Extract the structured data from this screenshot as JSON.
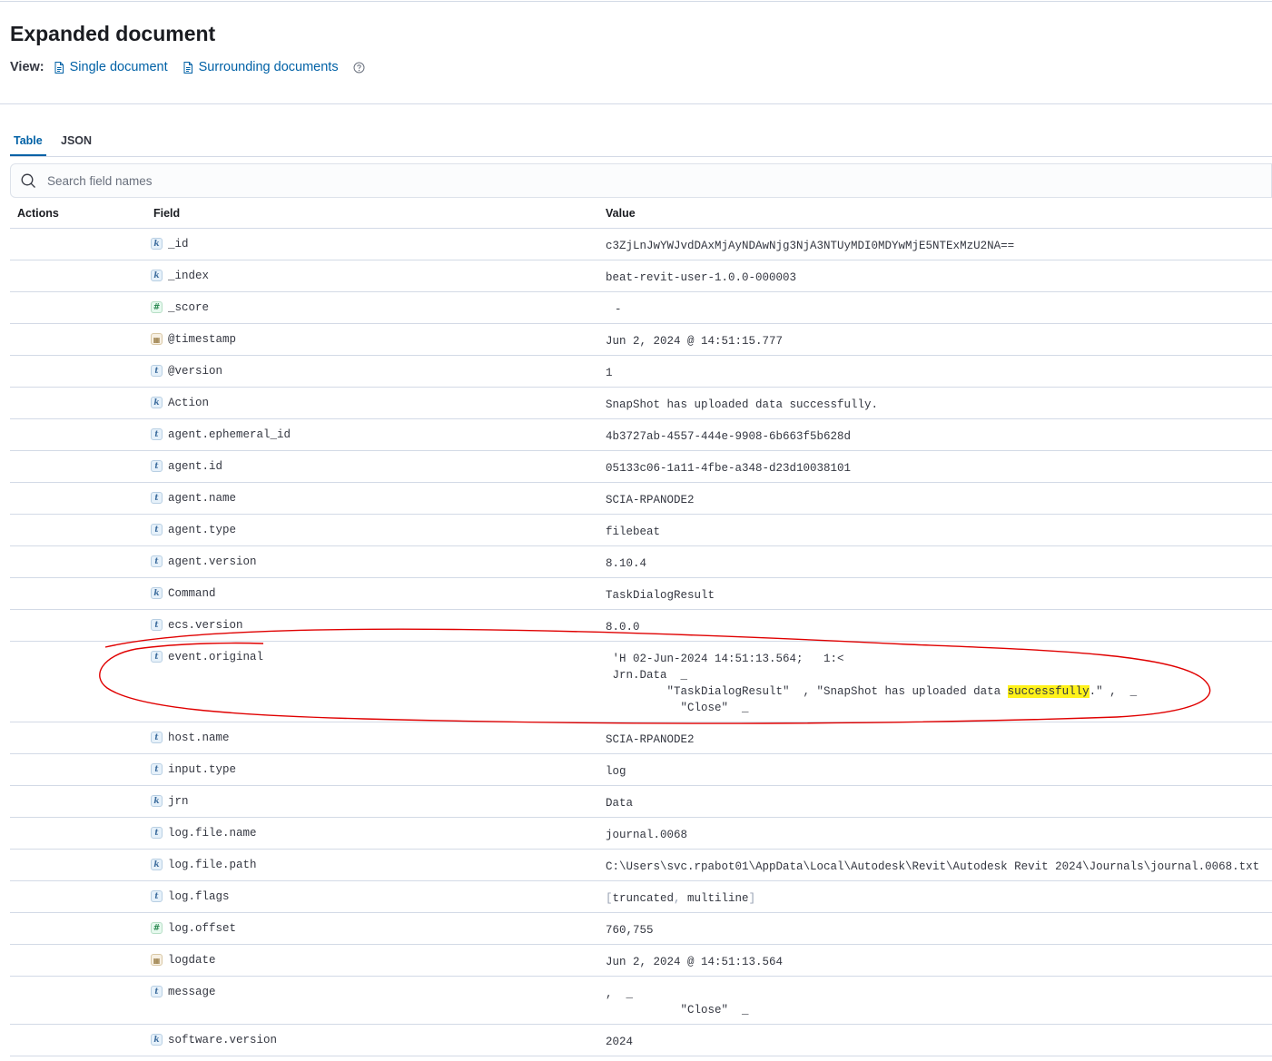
{
  "header": {
    "title": "Expanded document",
    "view_label": "View:",
    "single_document": "Single document",
    "surrounding_documents": "Surrounding documents"
  },
  "tabs": [
    {
      "label": "Table",
      "active": true
    },
    {
      "label": "JSON",
      "active": false
    }
  ],
  "search": {
    "placeholder": "Search field names"
  },
  "table": {
    "headers": {
      "actions": "Actions",
      "field": "Field",
      "value": "Value"
    },
    "rows": [
      {
        "type": "keyword",
        "field": "_id",
        "value": "c3ZjLnJwYWJvdDAxMjAyNDAwNjg3NjA3NTUyMDI0MDYwMjE5NTExMzU2NA=="
      },
      {
        "type": "keyword",
        "field": "_index",
        "value": "beat-revit-user-1.0.0-000003"
      },
      {
        "type": "number",
        "field": "_score",
        "value": "-"
      },
      {
        "type": "date",
        "field": "@timestamp",
        "value": "Jun 2, 2024 @ 14:51:15.777"
      },
      {
        "type": "text",
        "field": "@version",
        "value": "1"
      },
      {
        "type": "keyword",
        "field": "Action",
        "value": "SnapShot has uploaded data successfully."
      },
      {
        "type": "text",
        "field": "agent.ephemeral_id",
        "value": "4b3727ab-4557-444e-9908-6b663f5b628d"
      },
      {
        "type": "text",
        "field": "agent.id",
        "value": "05133c06-1a11-4fbe-a348-d23d10038101"
      },
      {
        "type": "text",
        "field": "agent.name",
        "value": "SCIA-RPANODE2"
      },
      {
        "type": "text",
        "field": "agent.type",
        "value": "filebeat"
      },
      {
        "type": "text",
        "field": "agent.version",
        "value": "8.10.4"
      },
      {
        "type": "keyword",
        "field": "Command",
        "value": "TaskDialogResult"
      },
      {
        "type": "text",
        "field": "ecs.version",
        "value": "8.0.0"
      },
      {
        "type": "text",
        "field": "event.original",
        "value_lines": [
          " 'H 02-Jun-2024 14:51:13.564;   1:<",
          " Jrn.Data  _",
          "         \"TaskDialogResult\"  , \"SnapShot has uploaded data ",
          "successfully",
          ".\" ,  _",
          "           \"Close\"  _"
        ]
      },
      {
        "type": "text",
        "field": "host.name",
        "value": "SCIA-RPANODE2"
      },
      {
        "type": "text",
        "field": "input.type",
        "value": "log"
      },
      {
        "type": "keyword",
        "field": "jrn",
        "value": "Data"
      },
      {
        "type": "text",
        "field": "log.file.name",
        "value": "journal.0068"
      },
      {
        "type": "keyword",
        "field": "log.file.path",
        "value": "C:\\Users\\svc.rpabot01\\AppData\\Local\\Autodesk\\Revit\\Autodesk Revit 2024\\Journals\\journal.0068.txt"
      },
      {
        "type": "text",
        "field": "log.flags",
        "value_parts": [
          "truncated",
          "multiline"
        ]
      },
      {
        "type": "number",
        "field": "log.offset",
        "value": "760,755"
      },
      {
        "type": "date",
        "field": "logdate",
        "value": "Jun 2, 2024 @ 14:51:13.564"
      },
      {
        "type": "text",
        "field": "message",
        "value_lines": [
          ",  _",
          "           \"Close\"  _"
        ]
      },
      {
        "type": "keyword",
        "field": "software.version",
        "value": "2024"
      }
    ]
  },
  "colors": {
    "link": "#0061a6",
    "highlight": "#fff21a",
    "annotation": "#e00000"
  }
}
